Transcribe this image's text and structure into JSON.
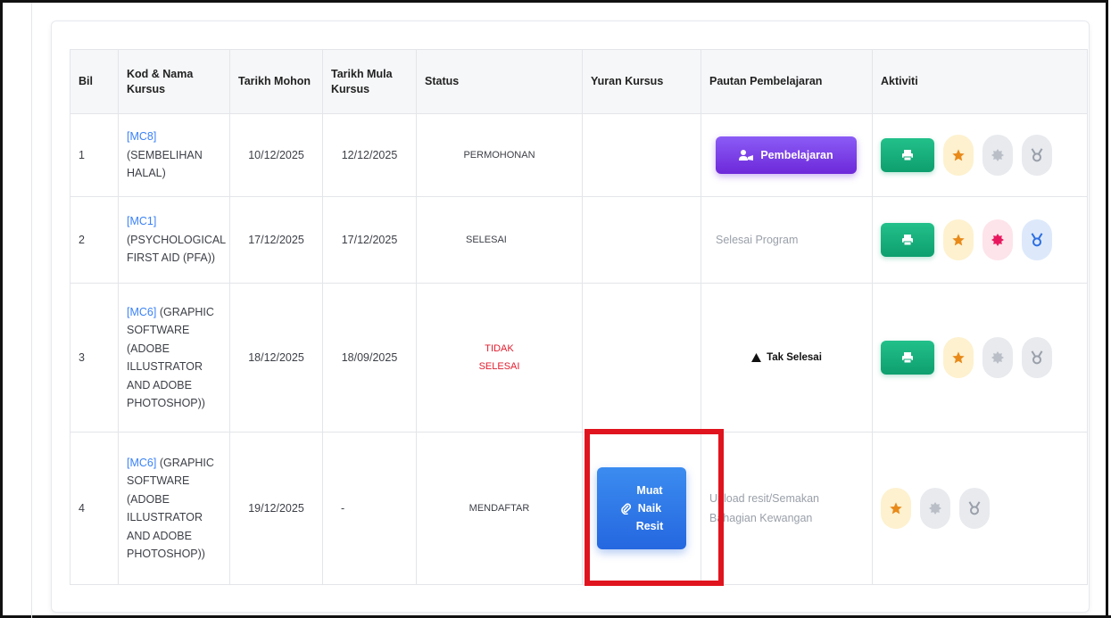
{
  "table": {
    "headers": {
      "bil": "Bil",
      "kod_nama_line1": "Kod & Nama",
      "kod_nama_line2": "Kursus",
      "tarikh_mohon": "Tarikh Mohon",
      "tarikh_mula_line1": "Tarikh Mula",
      "tarikh_mula_line2": "Kursus",
      "status": "Status",
      "yuran_kursus": "Yuran Kursus",
      "pautan": "Pautan Pembelajaran",
      "aktiviti": "Aktiviti"
    },
    "rows": [
      {
        "bil": "1",
        "code": "[MC8]",
        "name_lines": [
          "(SEMBELIHAN",
          "HALAL)"
        ],
        "tarikh_mohon": "10/12/2025",
        "tarikh_mula": "12/12/2025",
        "status": "PERMOHONAN",
        "pautan_button": "Pembelajaran"
      },
      {
        "bil": "2",
        "code": "[MC1]",
        "name_lines": [
          "(PSYCHOLOGICAL",
          "FIRST AID (PFA))"
        ],
        "tarikh_mohon": "17/12/2025",
        "tarikh_mula": "17/12/2025",
        "status": "SELESAI",
        "pautan_text": "Selesai Program"
      },
      {
        "bil": "3",
        "code": "[MC6]",
        "name_first_suffix": " (GRAPHIC",
        "name_lines": [
          "SOFTWARE",
          "(ADOBE",
          "ILLUSTRATOR",
          "AND ADOBE",
          "PHOTOSHOP))"
        ],
        "tarikh_mohon": "18/12/2025",
        "tarikh_mula": "18/09/2025",
        "status_lines": [
          "TIDAK",
          "SELESAI"
        ],
        "pautan_warning": "Tak Selesai"
      },
      {
        "bil": "4",
        "code": "[MC6]",
        "name_first_suffix": " (GRAPHIC",
        "name_lines": [
          "SOFTWARE",
          "(ADOBE",
          "ILLUSTRATOR",
          "AND ADOBE",
          "PHOTOSHOP))"
        ],
        "tarikh_mohon": "19/12/2025",
        "tarikh_mula": "-",
        "status": "MENDAFTAR",
        "upload_button_lines": [
          "Muat",
          "Naik",
          "Resit"
        ],
        "pautan_lines": [
          "Upload resit/Semakan",
          "Bahagian Kewangan"
        ]
      }
    ]
  },
  "colors": {
    "link_blue": "#3b82f6",
    "status_red": "#e11d2e",
    "purple_button": "#7c3aed",
    "green_print": "#16a97a",
    "upload_blue": "#2f78e8",
    "star_orange": "#e88a1a",
    "pink_badge": "#e8185f",
    "highlight_red": "#e0141e"
  },
  "icons": [
    "user-graduate-icon",
    "print-icon",
    "star-icon",
    "badge-icon",
    "medal-icon",
    "paperclip-icon",
    "warning-icon"
  ]
}
